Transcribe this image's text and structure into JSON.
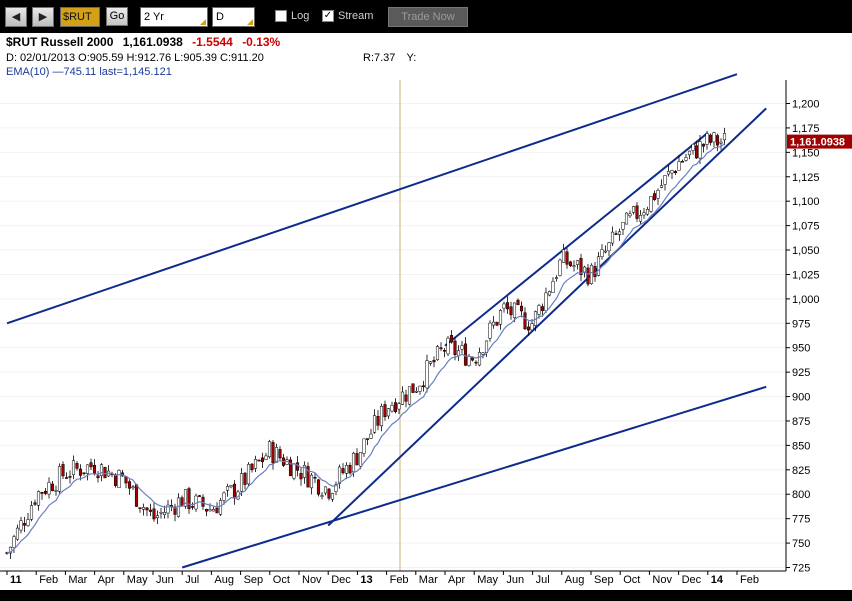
{
  "toolbar": {
    "back_label": "◀",
    "forward_label": "▶",
    "symbol": "$RUT",
    "go_label": "Go",
    "period": "2 Yr",
    "interval": "D",
    "log_label": "Log",
    "log_checked": false,
    "stream_label": "Stream",
    "stream_checked": true,
    "trade_label": "Trade Now"
  },
  "header": {
    "title": "$RUT Russell 2000",
    "last": "1,161.0938",
    "change": "-1.5544",
    "change_pct": "-0.13%",
    "ohlc": "D: 02/01/2013 O:905.59 H:912.76 L:905.39 C:911.20",
    "r_label": "R:7.37",
    "y_label": "Y:",
    "ema_label": "EMA(10) —745.11 last=1,145.121"
  },
  "colors": {
    "candle_up": "#ffffff",
    "candle_down": "#a00000",
    "candle_outline": "#000000",
    "ema": "#6a7fbf",
    "trendline": "#0d2b8c",
    "last_price_tag": "#a00000"
  },
  "chart_data": {
    "type": "candlestick",
    "title": "$RUT Russell 2000",
    "ylim": [
      725,
      1210
    ],
    "y_ticks": [
      "1,200",
      "1,175",
      "1,150",
      "1,125",
      "1,100",
      "1,075",
      "1,050",
      "1,025",
      "1,000",
      "975",
      "950",
      "925",
      "900",
      "875",
      "850",
      "825",
      "800",
      "775",
      "750",
      "725"
    ],
    "x_ticks": [
      "11",
      "Feb",
      "Mar",
      "Apr",
      "May",
      "Jun",
      "Jul",
      "Aug",
      "Sep",
      "Oct",
      "Nov",
      "Dec",
      "13",
      "Feb",
      "Mar",
      "Apr",
      "May",
      "Jun",
      "Jul",
      "Aug",
      "Sep",
      "Oct",
      "Nov",
      "Dec",
      "14",
      "Feb"
    ],
    "last_price_label": "1,161.0938",
    "closes_monthly": [
      {
        "x": "Dec 2011",
        "close": 740
      },
      {
        "x": "Jan 2012",
        "close": 800
      },
      {
        "x": "Feb 2012",
        "close": 822
      },
      {
        "x": "Mar 2012",
        "close": 830
      },
      {
        "x": "Apr 2012",
        "close": 815
      },
      {
        "x": "May 2012",
        "close": 775
      },
      {
        "x": "Jun 2012",
        "close": 795
      },
      {
        "x": "Jul 2012",
        "close": 785
      },
      {
        "x": "Aug 2012",
        "close": 810
      },
      {
        "x": "Sep 2012",
        "close": 845
      },
      {
        "x": "Oct 2012",
        "close": 825
      },
      {
        "x": "Nov 2012",
        "close": 805
      },
      {
        "x": "Dec 2012",
        "close": 840
      },
      {
        "x": "Jan 2013",
        "close": 890
      },
      {
        "x": "Feb 2013",
        "close": 911
      },
      {
        "x": "Mar 2013",
        "close": 950
      },
      {
        "x": "Apr 2013",
        "close": 940
      },
      {
        "x": "May 2013",
        "close": 990
      },
      {
        "x": "Jun 2013",
        "close": 975
      },
      {
        "x": "Jul 2013",
        "close": 1040
      },
      {
        "x": "Aug 2013",
        "close": 1025
      },
      {
        "x": "Sep 2013",
        "close": 1070
      },
      {
        "x": "Oct 2013",
        "close": 1100
      },
      {
        "x": "Nov 2013",
        "close": 1140
      },
      {
        "x": "Dec 2013",
        "close": 1161
      }
    ],
    "trendlines": [
      {
        "from": {
          "x": "Dec 2011",
          "y": 975
        },
        "to": {
          "x": "Jan 2014",
          "y": 1230
        }
      },
      {
        "from": {
          "x": "Jun 2012",
          "y": 725
        },
        "to": {
          "x": "Feb 2014",
          "y": 910
        }
      },
      {
        "from": {
          "x": "Nov 2012",
          "y": 768
        },
        "to": {
          "x": "Feb 2014",
          "y": 1195
        }
      },
      {
        "from": {
          "x": "Mar 2013",
          "y": 952
        },
        "to": {
          "x": "Dec 2013",
          "y": 1170
        }
      }
    ]
  }
}
